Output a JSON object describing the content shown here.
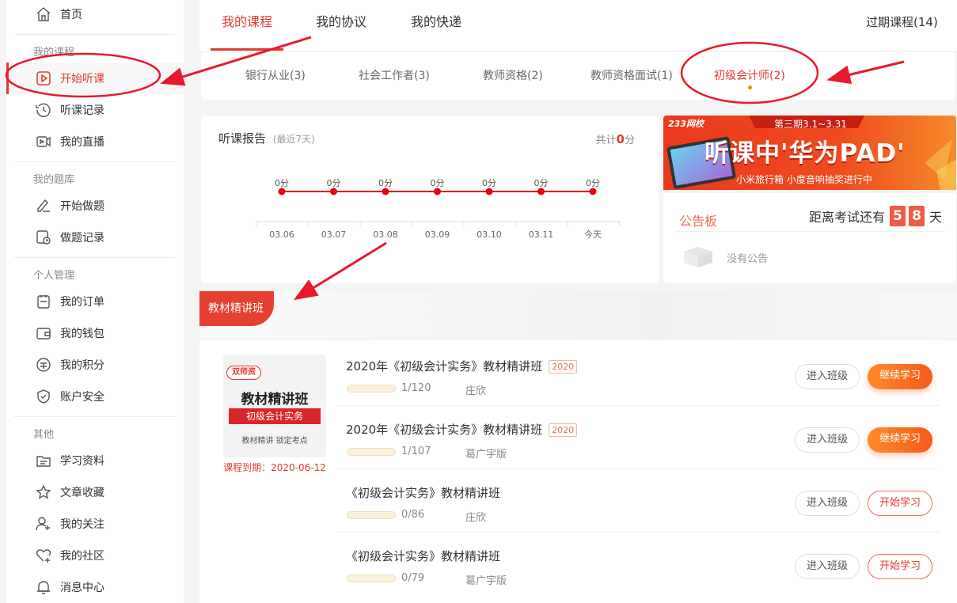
{
  "sidebar": {
    "home": "首页",
    "groups": {
      "courses": "我的课程",
      "questions": "我的题库",
      "personal": "个人管理",
      "other": "其他"
    },
    "items": {
      "start_listen": "开始听课",
      "listen_record": "听课记录",
      "my_live": "我的直播",
      "start_questions": "开始做题",
      "question_record": "做题记录",
      "my_orders": "我的订单",
      "my_wallet": "我的钱包",
      "my_points": "我的积分",
      "account_security": "账户安全",
      "study_materials": "学习资料",
      "article_favorites": "文章收藏",
      "my_follows": "我的关注",
      "my_community": "我的社区",
      "message_center": "消息中心"
    }
  },
  "tabs": [
    "我的课程",
    "我的协议",
    "我的快递"
  ],
  "expired": "过期课程(14)",
  "subtabs": [
    "银行从业(3)",
    "社会工作者(3)",
    "教师资格(2)",
    "教师资格面试(1)",
    "初级会计师(2)"
  ],
  "report": {
    "title": "听课报告",
    "range": "(最近7天)",
    "total_prefix": "共计",
    "total_value": "0",
    "total_unit": "分"
  },
  "chart_data": {
    "type": "line",
    "categories": [
      "03.06",
      "03.07",
      "03.08",
      "03.09",
      "03.10",
      "03.11",
      "今天"
    ],
    "values": [
      0,
      0,
      0,
      0,
      0,
      0,
      0
    ],
    "data_labels": [
      "0分",
      "0分",
      "0分",
      "0分",
      "0分",
      "0分",
      "0分"
    ],
    "color": "#e60012"
  },
  "ad": {
    "brand": "233网校",
    "period": "第三期3.1~3.31",
    "headline": "听课中'华为PAD'",
    "sub": "小米旅行箱 小度音响抽奖进行中"
  },
  "notice": {
    "title": "公告板",
    "countdown_prefix": "距离考试还有",
    "days": [
      "5",
      "8"
    ],
    "unit": "天",
    "empty": "没有公告"
  },
  "section_title": "教材精讲班",
  "cover": {
    "tag": "双师资",
    "title": "教材精讲班",
    "subtitle": "初级会计实务",
    "slogan": "教材精讲 锁定考点",
    "expiry": "课程到期：2020-06-12"
  },
  "courses": [
    {
      "title": "2020年《初级会计实务》教材精讲班",
      "year": "2020",
      "progress": "1/120",
      "teacher": "庄欣",
      "enter": "进入班级",
      "action": "继续学习"
    },
    {
      "title": "2020年《初级会计实务》教材精讲班",
      "year": "2020",
      "progress": "1/107",
      "teacher": "葛广宇版",
      "enter": "进入班级",
      "action": "继续学习"
    },
    {
      "title": "《初级会计实务》教材精讲班",
      "year": "",
      "progress": "0/86",
      "teacher": "庄欣",
      "enter": "进入班级",
      "action": "开始学习"
    },
    {
      "title": "《初级会计实务》教材精讲班",
      "year": "",
      "progress": "0/79",
      "teacher": "葛广宇版",
      "enter": "进入班级",
      "action": "开始学习"
    }
  ],
  "colors": {
    "accent": "#e23b2e",
    "orange": "#f45c1a",
    "annotation": "#e8192c"
  }
}
